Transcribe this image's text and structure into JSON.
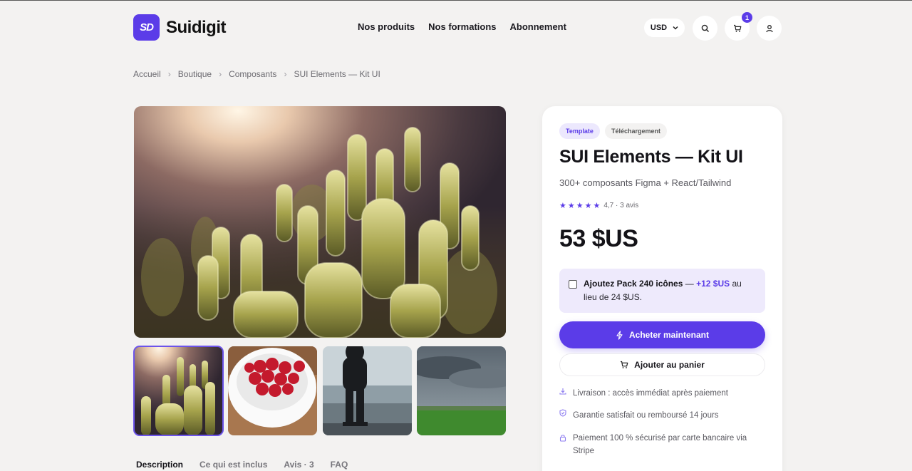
{
  "brand": {
    "logo_mark": "SD",
    "name": "Suidigit",
    "accent": "#5b3ce8"
  },
  "nav": {
    "items": [
      "Nos produits",
      "Nos formations",
      "Abonnement"
    ]
  },
  "header": {
    "currency": "USD",
    "cart_count": "1",
    "icons": [
      "search-icon",
      "cart-icon",
      "user-icon"
    ]
  },
  "breadcrumb": [
    "Accueil",
    "Boutique",
    "Composants",
    "SUI Elements — Kit UI"
  ],
  "gallery": {
    "thumbnails": [
      "cactus",
      "raspberries",
      "person-lake",
      "green-field"
    ]
  },
  "tabs": [
    "Description",
    "Ce qui est inclus",
    "Avis · 3",
    "FAQ"
  ],
  "product": {
    "tags": [
      "Template",
      "Téléchargement"
    ],
    "title": "SUI Elements — Kit UI",
    "subtitle": "300+ composants Figma + React/Tailwind",
    "stars": "★★★★★",
    "rating_text": "4,7 · 3 avis",
    "price": "53 $US",
    "addon": {
      "name": "Ajoutez Pack 240 icônes",
      "dash": " — ",
      "extra": "+12 $US",
      "rest": " au lieu de 24 $US."
    },
    "buy_label": "Acheter maintenant",
    "cart_label": "Ajouter au panier",
    "features": [
      "Livraison : accès immédiat après paiement",
      "Garantie satisfait ou remboursé 14 jours",
      "Paiement 100 % sécurisé par carte bancaire via Stripe"
    ]
  }
}
